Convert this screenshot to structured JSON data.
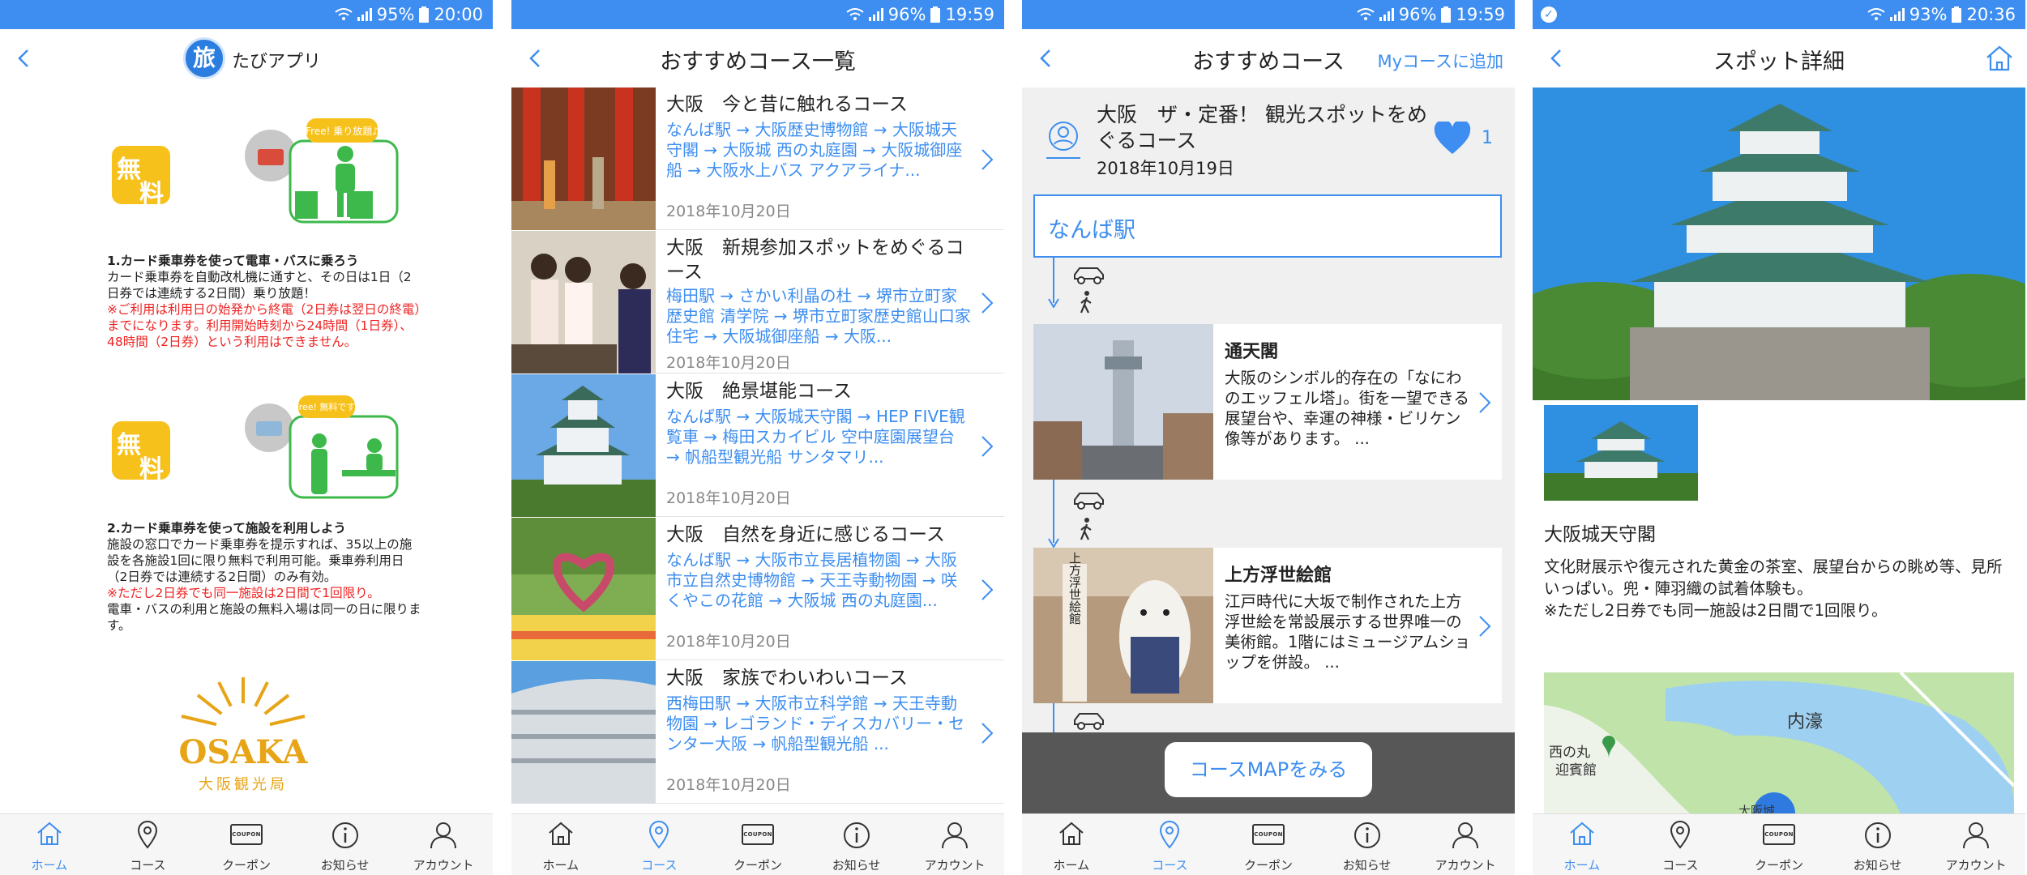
{
  "screens": {
    "home": {
      "status": {
        "battery": "95%",
        "time": "20:00"
      },
      "logo_char": "旅",
      "app_name": "たびアプリ",
      "badge_text_1": "無料",
      "badge_text_2": "無料",
      "illust1_tag": "Free! 乗り放題♪",
      "illust2_tag": "Free! 無料です!",
      "section1": {
        "title": "1.カード乗車券を使って電車・バスに乗ろう",
        "body": "カード乗車券を自動改札機に通すと、その日は1日（2日券では連続する2日間）乗り放題！",
        "note": "※ご利用は利用日の始発から終電（2日券は翌日の終電）までになります。利用開始時刻から24時間（1日券）、48時間（2日券）という利用はできません。"
      },
      "section2": {
        "title": "2.カード乗車券を使って施設を利用しよう",
        "body": "施設の窓口でカード乗車券を提示すれば、35以上の施設を各施設1回に限り無料で利用可能。乗車券利用日（2日券では連続する2日間）のみ有効。",
        "note": "※ただし2日券でも同一施設は2日間で1回限り。",
        "body2": "電車・バスの利用と施設の無料入場は同一の日に限ります。"
      },
      "osaka_logo": {
        "word": "OSAKA",
        "sub": "大阪観光局"
      }
    },
    "course_list": {
      "status": {
        "battery": "96%",
        "time": "19:59"
      },
      "title": "おすすめコース一覧",
      "courses": [
        {
          "title": "大阪　今と昔に触れるコース",
          "route": "なんば駅 → 大阪歴史博物館 → 大阪城天守閣 → 大阪城 西の丸庭園 → 大阪城御座船 → 大阪水上バス アクアライナ...",
          "date": "2018年10月20日"
        },
        {
          "title": "大阪　新規参加スポットをめぐるコース",
          "route": "梅田駅 → さかい利晶の杜 → 堺市立町家歴史館 清学院 → 堺市立町家歴史館山口家住宅 → 大阪城御座船 → 大阪...",
          "date": "2018年10月20日"
        },
        {
          "title": "大阪　絶景堪能コース",
          "route": "なんば駅 → 大阪城天守閣 → HEP FIVE観覧車 → 梅田スカイビル 空中庭園展望台 → 帆船型観光船 サンタマリ...",
          "date": "2018年10月20日"
        },
        {
          "title": "大阪　自然を身近に感じるコース",
          "route": "なんば駅 → 大阪市立長居植物園 → 大阪市立自然史博物館 → 天王寺動物園 → 咲くやこの花館 → 大阪城 西の丸庭園...",
          "date": "2018年10月20日"
        },
        {
          "title": "大阪　家族でわいわいコース",
          "route": "西梅田駅 → 大阪市立科学館 → 天王寺動物園 → レゴランド・ディスカバリー・センター大阪 → 帆船型観光船 ...",
          "date": "2018年10月20日"
        }
      ]
    },
    "course_detail": {
      "status": {
        "battery": "96%",
        "time": "19:59"
      },
      "title": "おすすめコース",
      "action": "Myコースに追加",
      "course_title": "大阪　ザ・定番！ 観光スポットをめぐるコース",
      "date": "2018年10月19日",
      "likes": "1",
      "start": "なんば駅",
      "spots": [
        {
          "name": "通天閣",
          "desc": "大阪のシンボル的存在の「なにわのエッフェル塔」。街を一望できる展望台や、幸運の神様・ビリケン像等があります。 ..."
        },
        {
          "name": "上方浮世絵館",
          "desc": "江戸時代に大坂で制作された上方浮世絵を常設展示する世界唯一の美術館。1階にはミュージアムショップを併設。 ..."
        }
      ],
      "sign_text": "上方浮世絵館",
      "map_button": "コースMAPをみる"
    },
    "spot_detail": {
      "status": {
        "battery": "93%",
        "time": "20:36"
      },
      "title": "スポット詳細",
      "spot_name": "大阪城天守閣",
      "desc": "文化財展示や復元された黄金の茶室、展望台からの眺め等、見所いっぱい。兜・陣羽織の試着体験も。",
      "note": "※ただし2日券でも同一施設は2日間で1回限り。",
      "map_labels": {
        "moat": "内濠",
        "place1": "西の丸",
        "place2": "迎賓館",
        "bottom": "大阪城"
      }
    }
  },
  "nav": {
    "home": "ホーム",
    "course": "コース",
    "coupon": "クーポン",
    "news": "お知らせ",
    "account": "アカウント",
    "coupon_box": "COUPON"
  },
  "colors": {
    "accent": "#3d8ef0",
    "badge_yellow": "#f7c11c",
    "illust_green": "#3cb94a",
    "note_red": "#e22222",
    "osaka_gold": "#e7a416"
  },
  "icons": [
    "back-chevron-icon",
    "home-icon",
    "pin-icon",
    "coupon-icon",
    "info-icon",
    "person-icon",
    "heart-icon",
    "car-icon",
    "walk-icon",
    "wifi-icon",
    "signal-icon",
    "battery-icon"
  ]
}
